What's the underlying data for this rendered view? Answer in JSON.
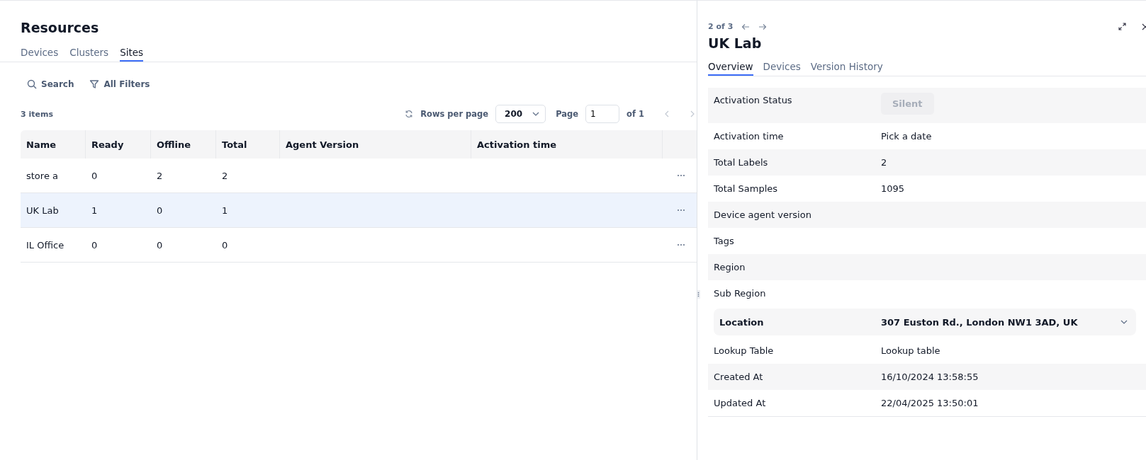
{
  "page": {
    "title": "Resources"
  },
  "tabs": [
    {
      "label": "Devices",
      "selected": false
    },
    {
      "label": "Clusters",
      "selected": false
    },
    {
      "label": "Sites",
      "selected": true
    }
  ],
  "toolbar": {
    "search": "Search",
    "filters": "All Filters"
  },
  "table_meta": {
    "count": "3 items",
    "rows_per_page_label": "Rows per page",
    "rows_per_page": "200",
    "page_label": "Page",
    "page": "1",
    "of_pages": "of 1"
  },
  "table": {
    "columns": [
      "Name",
      "Ready",
      "Offline",
      "Total",
      "Agent Version",
      "Activation time"
    ],
    "rows": [
      {
        "cells": [
          "store a",
          "0",
          "2",
          "2",
          "",
          ""
        ],
        "selected": false
      },
      {
        "cells": [
          "UK Lab",
          "1",
          "0",
          "1",
          "",
          ""
        ],
        "selected": true
      },
      {
        "cells": [
          "IL Office",
          "0",
          "0",
          "0",
          "",
          ""
        ],
        "selected": false
      }
    ]
  },
  "detail": {
    "position": "2 of 3",
    "title": "UK Lab",
    "tabs": [
      {
        "label": "Overview",
        "selected": true
      },
      {
        "label": "Devices",
        "selected": false
      },
      {
        "label": "Version History",
        "selected": false
      }
    ],
    "fields": [
      {
        "kind": "badge",
        "label": "Activation Status",
        "value": "Silent"
      },
      {
        "kind": "text",
        "label": "Activation time",
        "value": "Pick a date"
      },
      {
        "kind": "text",
        "label": "Total Labels",
        "value": "2"
      },
      {
        "kind": "text",
        "label": "Total Samples",
        "value": "1095"
      },
      {
        "kind": "text",
        "label": "Device agent version"
      },
      {
        "kind": "text",
        "label": "Tags"
      },
      {
        "kind": "text",
        "label": "Region"
      },
      {
        "kind": "text",
        "label": "Sub Region"
      },
      {
        "kind": "expandable",
        "label": "Location",
        "value": "307 Euston Rd., London NW1 3AD, UK",
        "expanded": false
      },
      {
        "kind": "text",
        "label": "Lookup Table",
        "value": "Lookup table"
      },
      {
        "kind": "text",
        "label": "Created At",
        "value": "16/10/2024 13:58:55"
      },
      {
        "kind": "text",
        "label": "Updated At",
        "value": "22/04/2025 13:50:01"
      }
    ]
  }
}
